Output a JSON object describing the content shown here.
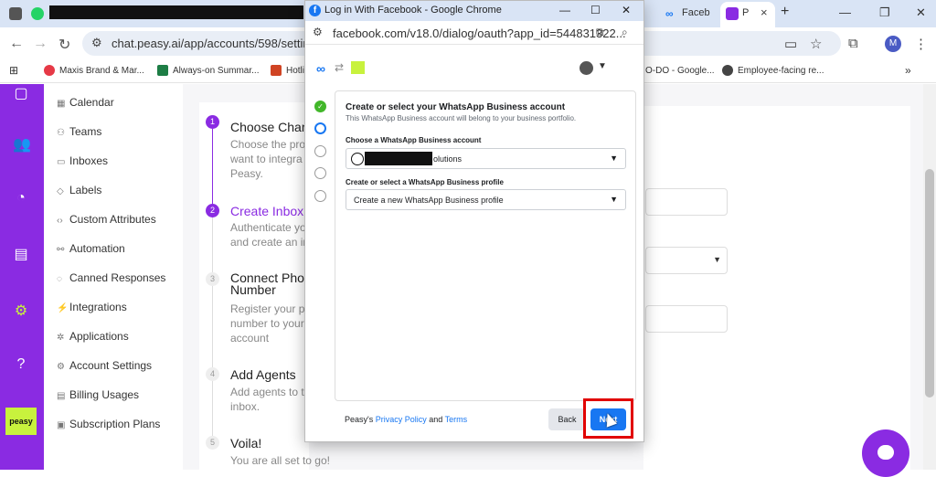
{
  "browser": {
    "tabs": [
      {
        "label": "Faceb"
      },
      {
        "label": "P"
      }
    ],
    "url": "chat.peasy.ai/app/accounts/598/settings/in",
    "bookmarks": [
      "Maxis Brand & Mar...",
      "Always-on Summar...",
      "Hotli",
      "O-DO - Google...",
      "Employee-facing re..."
    ],
    "avatar_letter": "M",
    "colors": {
      "tabbar": "#d9e4f5",
      "brand_purple": "#8a2be2"
    }
  },
  "app": {
    "logo_text": "peasy",
    "rail_icons": [
      "chat-icon",
      "contacts-icon",
      "reports-icon",
      "clipboard-icon",
      "settings-gear-icon",
      "help-icon"
    ],
    "settings_nav": [
      {
        "icon": "calendar-icon",
        "label": "Calendar"
      },
      {
        "icon": "teams-icon",
        "label": "Teams"
      },
      {
        "icon": "inbox-icon",
        "label": "Inboxes"
      },
      {
        "icon": "tag-icon",
        "label": "Labels"
      },
      {
        "icon": "code-icon",
        "label": "Custom Attributes"
      },
      {
        "icon": "automation-icon",
        "label": "Automation"
      },
      {
        "icon": "canned-icon",
        "label": "Canned Responses"
      },
      {
        "icon": "plug-icon",
        "label": "Integrations"
      },
      {
        "icon": "apps-icon",
        "label": "Applications"
      },
      {
        "icon": "account-settings-icon",
        "label": "Account Settings"
      },
      {
        "icon": "billing-icon",
        "label": "Billing Usages"
      },
      {
        "icon": "subscription-icon",
        "label": "Subscription Plans"
      }
    ],
    "wizard": [
      {
        "num": "1",
        "title": "Choose Chan",
        "desc": "Choose the pro want to integra Peasy."
      },
      {
        "num": "2",
        "title": "Create Inbox",
        "desc": "Authenticate yo and create an ir"
      },
      {
        "num": "3",
        "title": "Connect Phor Number",
        "desc": "Register your p number to your account"
      },
      {
        "num": "4",
        "title": "Add Agents",
        "desc": "Add agents to t inbox."
      },
      {
        "num": "5",
        "title": "Voila!",
        "desc": "You are all set to go!"
      }
    ]
  },
  "popup": {
    "window_title": "Log in With Facebook - Google Chrome",
    "url": "facebook.com/v18.0/dialog/oauth?app_id=544831322...",
    "form": {
      "title": "Create or select your WhatsApp Business account",
      "subtitle": "This WhatsApp Business account will belong to your business portfolio.",
      "account_label": "Choose a WhatsApp Business account",
      "account_value_suffix": "olutions",
      "profile_label": "Create or select a WhatsApp Business profile",
      "profile_value": "Create a new WhatsApp Business profile"
    },
    "footer": {
      "prefix": "Peasy's",
      "privacy_link": "Privacy Policy",
      "and": "and",
      "terms_link": "Terms"
    },
    "buttons": {
      "back": "Back",
      "next": "Next"
    },
    "colors": {
      "facebook_blue": "#1877f2",
      "done_green": "#42b72a",
      "highlight_red": "#e10000"
    }
  }
}
